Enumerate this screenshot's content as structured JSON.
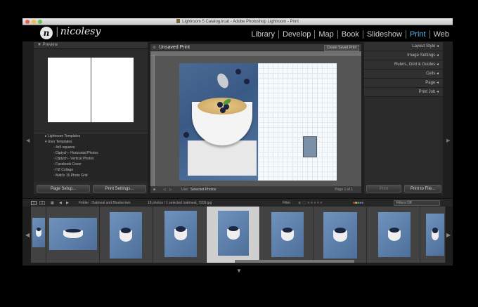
{
  "window": {
    "title": "Lightroom 5 Catalog.lrcat - Adobe Photoshop Lightroom - Print"
  },
  "identity": {
    "logo_letter": "n",
    "brand": "nicolesy"
  },
  "modules": [
    {
      "label": "Library"
    },
    {
      "label": "Develop"
    },
    {
      "label": "Map"
    },
    {
      "label": "Book"
    },
    {
      "label": "Slideshow"
    },
    {
      "label": "Print"
    },
    {
      "label": "Web"
    }
  ],
  "active_module": "Print",
  "left_panel": {
    "preview_label": "Preview",
    "templates": [
      {
        "label": "Lightroom Templates",
        "level": 0
      },
      {
        "label": "User Templates",
        "level": 0
      },
      {
        "label": "4x5 squares",
        "level": 1
      },
      {
        "label": "Diptych - Horizontal Photos",
        "level": 1
      },
      {
        "label": "Diptych - Vertical Photos",
        "level": 1
      },
      {
        "label": "Facebook Cover",
        "level": 1
      },
      {
        "label": "HZ Collage",
        "level": 1
      },
      {
        "label": "Matt's 15 Photo Grid",
        "level": 1
      }
    ],
    "page_setup_label": "Page Setup...",
    "print_settings_label": "Print Settings..."
  },
  "center": {
    "title": "Unsaved Print",
    "create_saved_label": "Create Saved Print",
    "use_label": "Use:",
    "use_value": "Selected Photos",
    "page_label": "Page 1 of 1"
  },
  "right_panel": {
    "sections": [
      "Layout Style",
      "Image Settings",
      "Rulers, Grid & Guides",
      "Cells",
      "Page",
      "Print Job"
    ],
    "print_label": "Print",
    "print_to_file_label": "Print to File..."
  },
  "filmstrip_bar": {
    "page_1": "1",
    "page_2": "2",
    "folder_label": "Folder : Oatmeal and Blueberries",
    "count_label": "18 photos / 1 selected /oatmeal_7209.jpg",
    "filter_label": "Filter :",
    "filters_value": "Filters Off"
  },
  "colors": {
    "accent": "#58b6e8",
    "panel": "#2a2a2a",
    "background": "#1e1e1e"
  }
}
